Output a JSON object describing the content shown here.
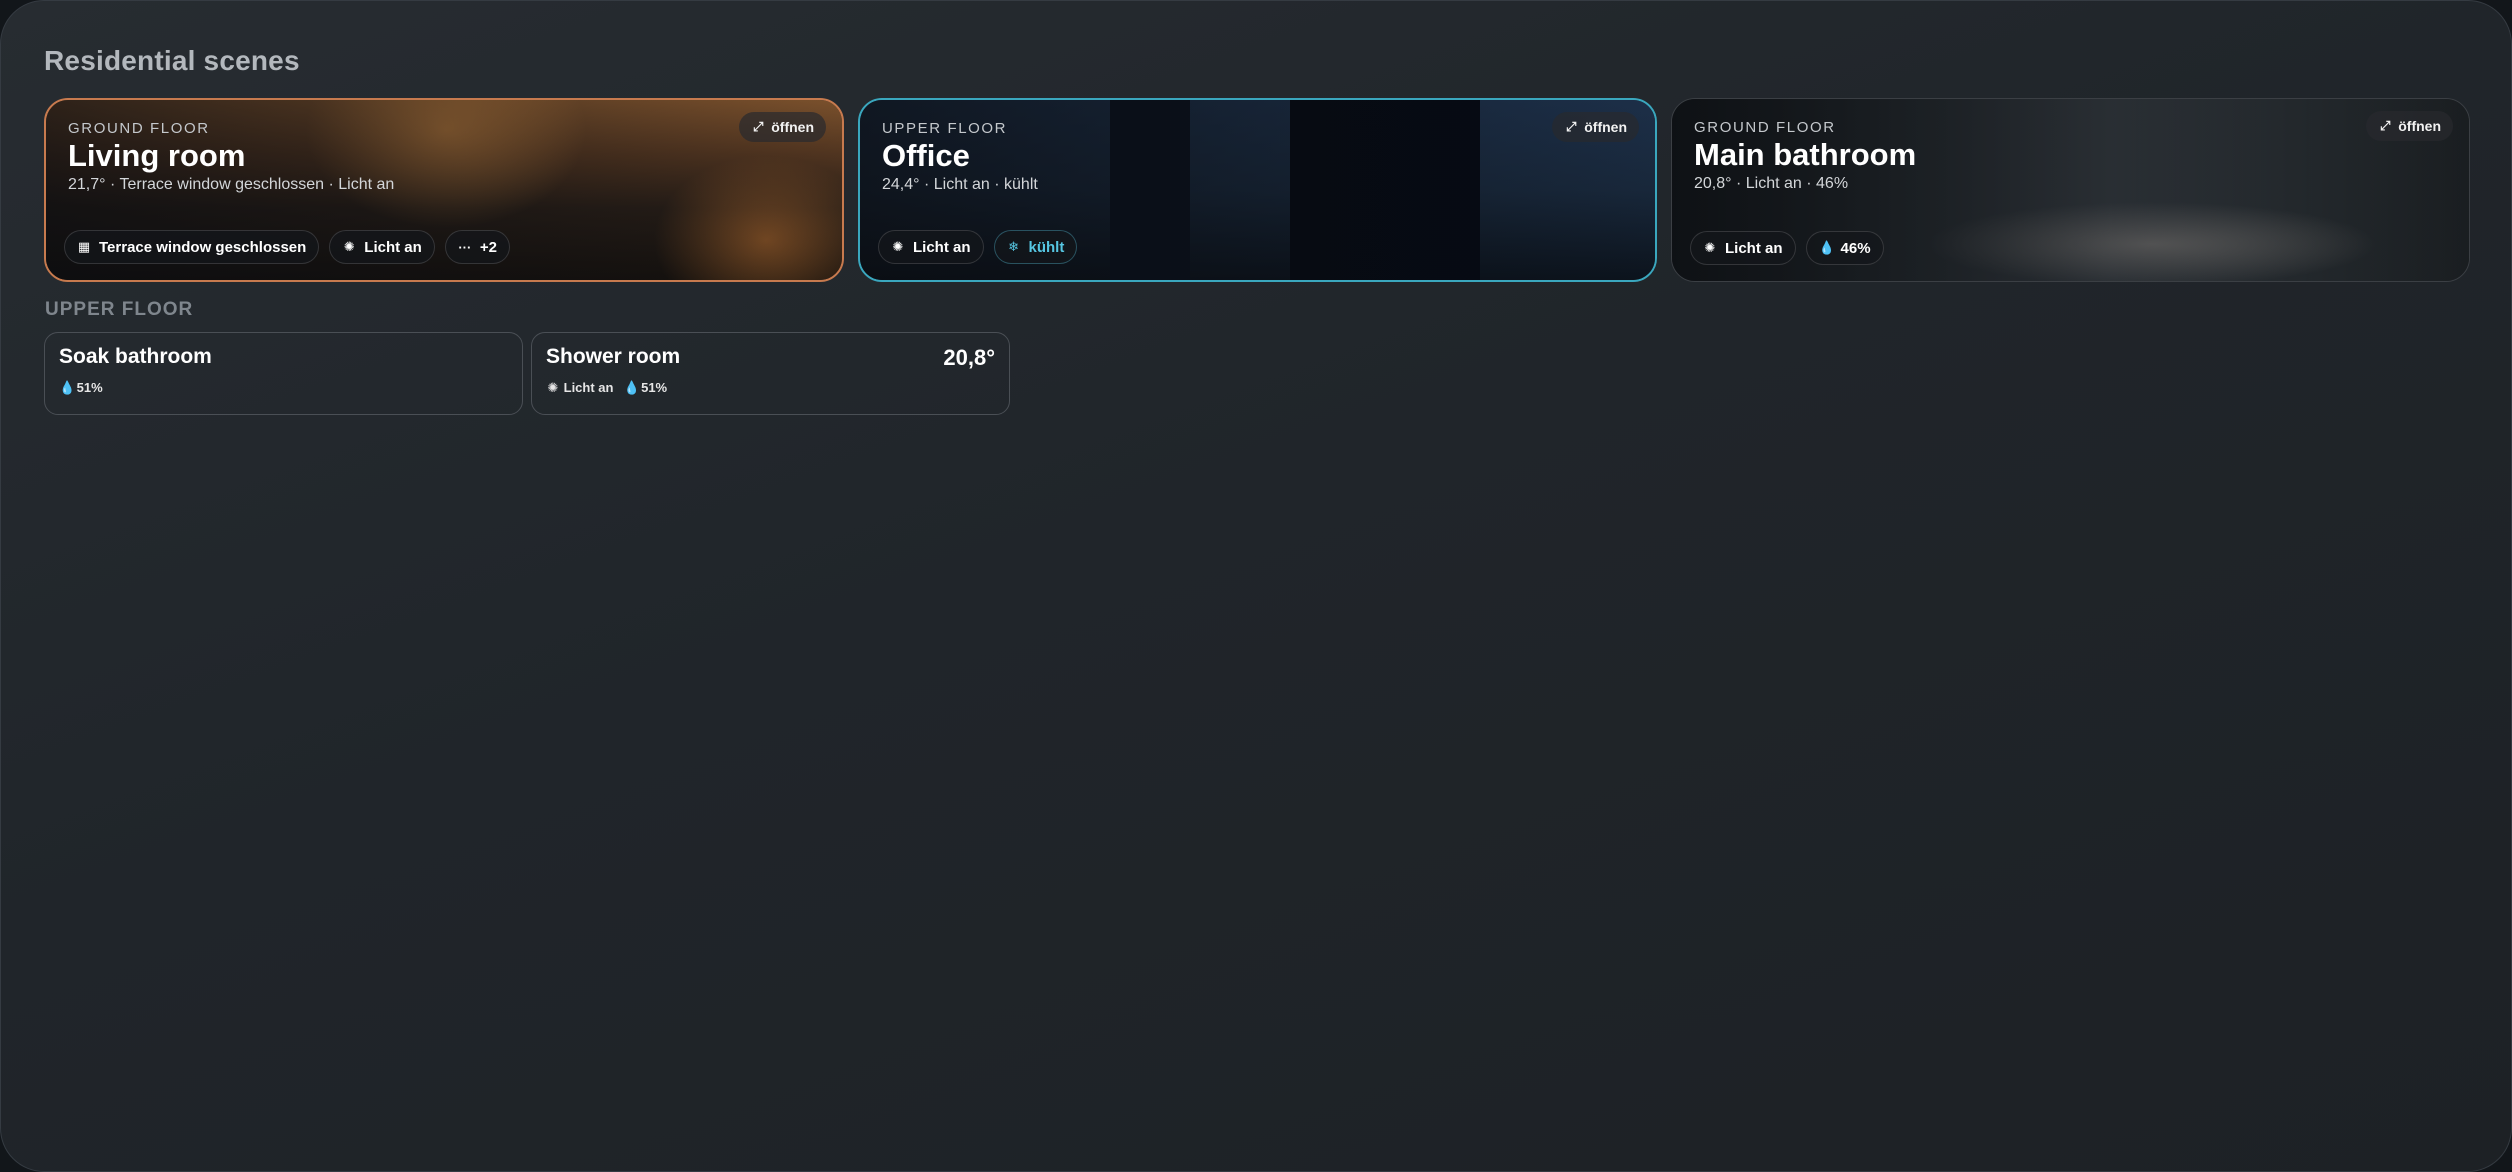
{
  "page": {
    "title": "Residential scenes"
  },
  "scenes": [
    {
      "floor": "GROUND FLOOR",
      "name": "Living room",
      "summary": "21,7° · Terrace window geschlossen · Licht an",
      "open_label": "öffnen",
      "chips": [
        {
          "icon": "window-grid-icon",
          "label": "Terrace window geschlossen"
        },
        {
          "icon": "lightbulb-icon",
          "label": "Licht an"
        },
        {
          "icon": "more-dots-icon",
          "label": "+2"
        }
      ]
    },
    {
      "floor": "UPPER FLOOR",
      "name": "Office",
      "summary": "24,4° · Licht an · kühlt",
      "open_label": "öffnen",
      "chips": [
        {
          "icon": "lightbulb-icon",
          "label": "Licht an"
        },
        {
          "icon": "snowflake-icon",
          "label": "kühlt"
        }
      ]
    },
    {
      "floor": "GROUND FLOOR",
      "name": "Main bathroom",
      "summary": "20,8° · Licht an · 46%",
      "open_label": "öffnen",
      "chips": [
        {
          "icon": "lightbulb-icon",
          "label": "Licht an"
        },
        {
          "icon": "droplet-icon",
          "label": "46%"
        }
      ]
    }
  ],
  "upper_floor": {
    "title": "UPPER FLOOR",
    "rooms": [
      {
        "name": "Soak bathroom",
        "humidity": "51%",
        "temperature": null,
        "light": null
      },
      {
        "name": "Shower room",
        "temperature": "20,8°",
        "light": "Licht an",
        "humidity": "51%"
      }
    ]
  },
  "colors": {
    "accent_warm": "#c77a4e",
    "accent_cool": "#3aa7be",
    "cooling_text": "#56c6e2"
  }
}
